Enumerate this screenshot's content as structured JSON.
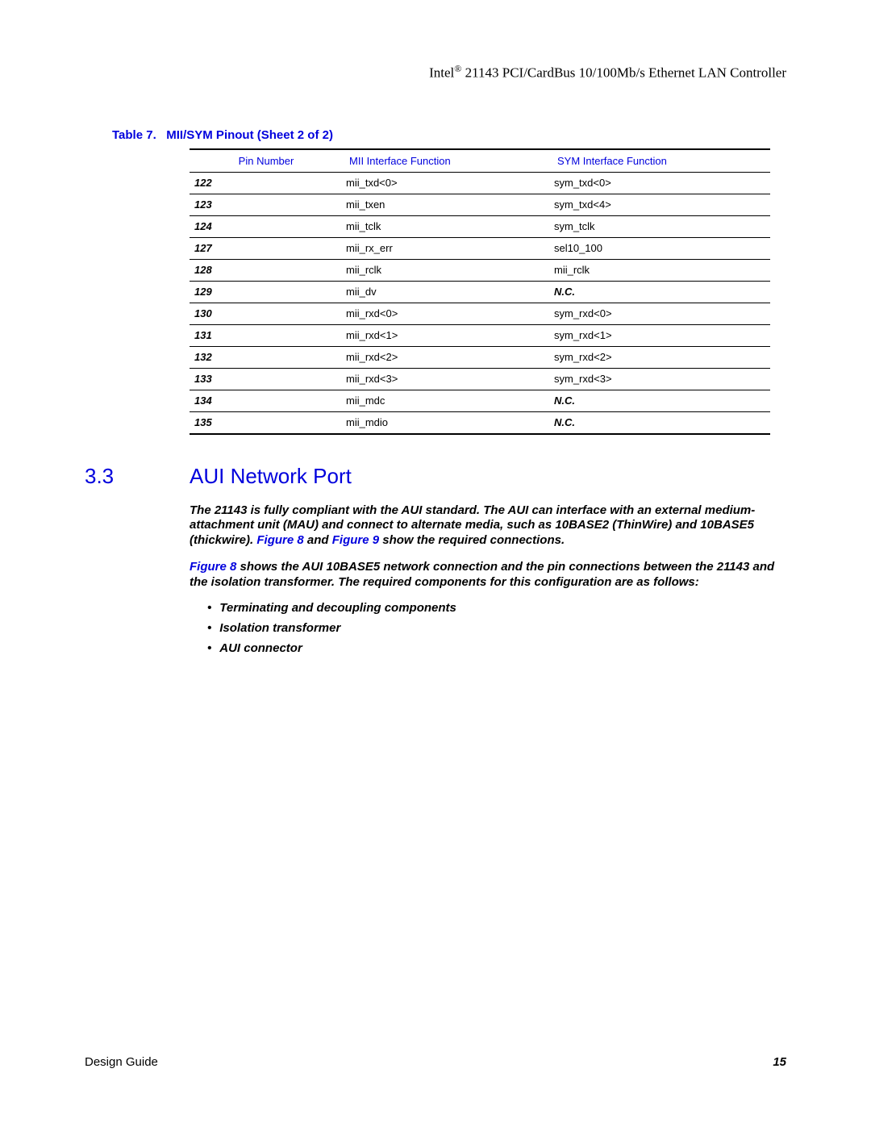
{
  "header": {
    "brand": "Intel",
    "reg": "®",
    "title_rest": " 21143 PCI/CardBus 10/100Mb/s Ethernet LAN Controller"
  },
  "table_caption_prefix": "Table 7.",
  "table_caption": "MII/SYM Pinout (Sheet 2 of 2)",
  "columns": {
    "c0": "Pin Number",
    "c1": "MII Interface Function",
    "c2": "SYM Interface Function"
  },
  "rows": [
    {
      "pin": "122",
      "mii": "mii_txd<0>",
      "sym": "sym_txd<0>",
      "nc": false
    },
    {
      "pin": "123",
      "mii": "mii_txen",
      "sym": "sym_txd<4>",
      "nc": false
    },
    {
      "pin": "124",
      "mii": "mii_tclk",
      "sym": "sym_tclk",
      "nc": false
    },
    {
      "pin": "127",
      "mii": "mii_rx_err",
      "sym": "sel10_100",
      "nc": false
    },
    {
      "pin": "128",
      "mii": "mii_rclk",
      "sym": "mii_rclk",
      "nc": false
    },
    {
      "pin": "129",
      "mii": "mii_dv",
      "sym": "N.C.",
      "nc": true
    },
    {
      "pin": "130",
      "mii": "mii_rxd<0>",
      "sym": "sym_rxd<0>",
      "nc": false
    },
    {
      "pin": "131",
      "mii": "mii_rxd<1>",
      "sym": "sym_rxd<1>",
      "nc": false
    },
    {
      "pin": "132",
      "mii": "mii_rxd<2>",
      "sym": "sym_rxd<2>",
      "nc": false
    },
    {
      "pin": "133",
      "mii": "mii_rxd<3>",
      "sym": "sym_rxd<3>",
      "nc": false
    },
    {
      "pin": "134",
      "mii": "mii_mdc",
      "sym": "N.C.",
      "nc": true
    },
    {
      "pin": "135",
      "mii": "mii_mdio",
      "sym": "N.C.",
      "nc": true
    }
  ],
  "section": {
    "num": "3.3",
    "title": "AUI Network Port"
  },
  "para1_a": "The 21143 is fully compliant with the AUI standard. The AUI can interface with an external medium-attachment unit (MAU) and connect to alternate media, such as 10BASE2 (ThinWire) and 10BASE5 (thickwire). ",
  "fig8": "Figure 8",
  "para1_b": " and ",
  "fig9": "Figure 9",
  "para1_c": " show the required connections.",
  "para2_a_ref": "Figure 8",
  "para2_b": " shows the AUI 10BASE5 network connection and the pin connections between the 21143 and the isolation transformer. The required components for this configuration are as follows:",
  "bullets": [
    "Terminating and decoupling components",
    "Isolation transformer",
    "AUI connector"
  ],
  "footer": {
    "left": "Design Guide",
    "right": "15"
  }
}
